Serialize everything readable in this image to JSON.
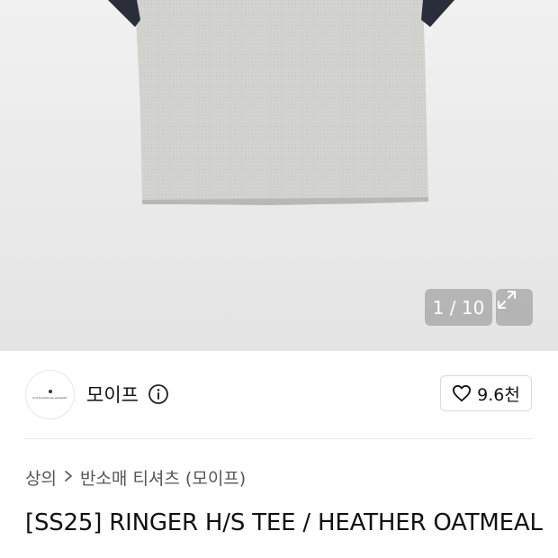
{
  "gallery": {
    "counter": "1 / 10",
    "expand_icon": "expand-arrows-icon"
  },
  "brand": {
    "name": "모이프",
    "logo_text": "mot  fonctionnel  authentic",
    "info_icon": "info-icon"
  },
  "like": {
    "icon": "heart-icon",
    "count": "9.6천"
  },
  "breadcrumb": {
    "items": [
      "상의",
      "반소매 티셔츠 (모이프)"
    ],
    "separator_icon": "chevron-right-icon"
  },
  "product": {
    "title": "[SS25] RINGER H/S TEE / HEATHER OATMEAL"
  }
}
